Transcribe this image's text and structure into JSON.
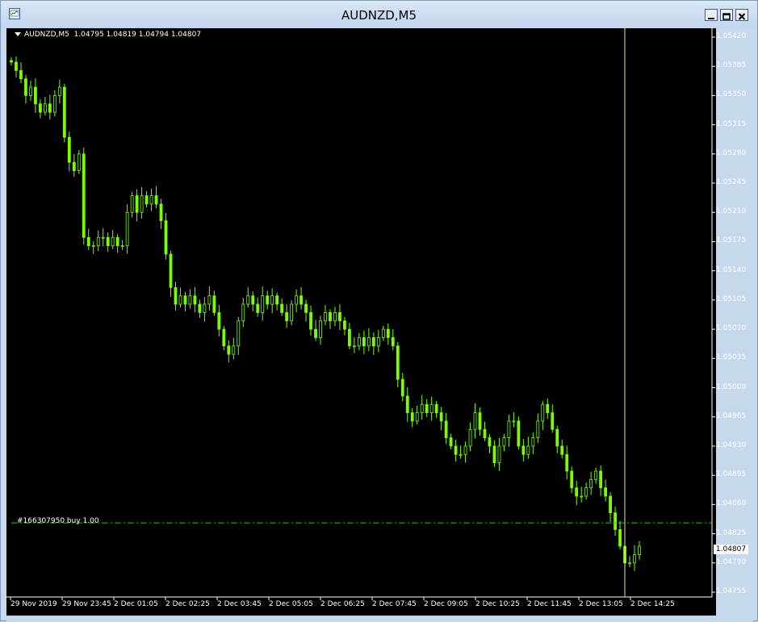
{
  "window": {
    "title": "AUDNZD,M5"
  },
  "chart_info": {
    "symbol_period": "AUDNZD,M5",
    "ohlc": "1.04795 1.04819 1.04794 1.04807"
  },
  "order": {
    "label": "#166307950 buy 1.00",
    "price": 1.04838
  },
  "current_price": {
    "label": "1.04807",
    "value": 1.04807
  },
  "colors": {
    "background": "#000000",
    "candle": "#7CFC00",
    "order_line": "#22c322",
    "cursor_line": "#f0e68c",
    "text": "#ffffff"
  },
  "icons": {
    "app": "mt4-chart-icon",
    "minimize": "minimize-icon",
    "maximize": "maximize-icon",
    "close": "close-icon",
    "menu": "triangle-down-icon"
  },
  "y_ticks": [
    "1.05420",
    "1.05385",
    "1.05350",
    "1.05315",
    "1.05280",
    "1.05245",
    "1.05210",
    "1.05175",
    "1.05140",
    "1.05105",
    "1.05070",
    "1.05035",
    "1.05000",
    "1.04965",
    "1.04930",
    "1.04895",
    "1.04860",
    "1.04825",
    "1.04790",
    "1.04755"
  ],
  "x_ticks": [
    "29 Nov 2019",
    "29 Nov 23:45",
    "2 Dec 01:05",
    "2 Dec 02:25",
    "2 Dec 03:45",
    "2 Dec 05:05",
    "2 Dec 06:25",
    "2 Dec 07:45",
    "2 Dec 09:05",
    "2 Dec 10:25",
    "2 Dec 11:45",
    "2 Dec 13:05",
    "2 Dec 14:25"
  ],
  "chart_data": {
    "type": "candlestick",
    "symbol": "AUDNZD",
    "timeframe": "M5",
    "ylim": [
      1.04755,
      1.0542
    ],
    "closes_approx": [
      1.0539,
      1.0538,
      1.0537,
      1.0535,
      1.0536,
      1.0534,
      1.0533,
      1.0534,
      1.0533,
      1.0535,
      1.0536,
      1.053,
      1.0527,
      1.0526,
      1.0528,
      1.0518,
      1.0517,
      1.0517,
      1.0518,
      1.0518,
      1.0517,
      1.0518,
      1.0517,
      1.0517,
      1.0521,
      1.0523,
      1.0521,
      1.0523,
      1.0522,
      1.0523,
      1.0522,
      1.052,
      1.0516,
      1.0512,
      1.051,
      1.0511,
      1.051,
      1.0511,
      1.051,
      1.0509,
      1.051,
      1.0511,
      1.0509,
      1.0507,
      1.0505,
      1.0504,
      1.0505,
      1.0508,
      1.051,
      1.0511,
      1.051,
      1.0509,
      1.0511,
      1.051,
      1.0511,
      1.051,
      1.0509,
      1.0508,
      1.051,
      1.0511,
      1.051,
      1.0509,
      1.0507,
      1.0506,
      1.0508,
      1.0509,
      1.0508,
      1.0509,
      1.0508,
      1.0507,
      1.0505,
      1.0505,
      1.0506,
      1.0505,
      1.0506,
      1.0505,
      1.0506,
      1.0507,
      1.0506,
      1.0505,
      1.0501,
      1.0499,
      1.0497,
      1.0496,
      1.0497,
      1.0498,
      1.0497,
      1.0498,
      1.0497,
      1.0496,
      1.0494,
      1.0493,
      1.0492,
      1.0492,
      1.0493,
      1.0495,
      1.0497,
      1.0495,
      1.0494,
      1.0493,
      1.0491,
      1.0493,
      1.0494,
      1.0496,
      1.0496,
      1.0493,
      1.0492,
      1.0493,
      1.0494,
      1.0496,
      1.0498,
      1.0497,
      1.0495,
      1.0493,
      1.0492,
      1.049,
      1.0488,
      1.0487,
      1.0487,
      1.0488,
      1.0489,
      1.049,
      1.0488,
      1.0487,
      1.0485,
      1.0483,
      1.0481,
      1.0479,
      1.0479,
      1.048,
      1.0481
    ],
    "order_line": 1.04838,
    "current_price": 1.04807
  }
}
